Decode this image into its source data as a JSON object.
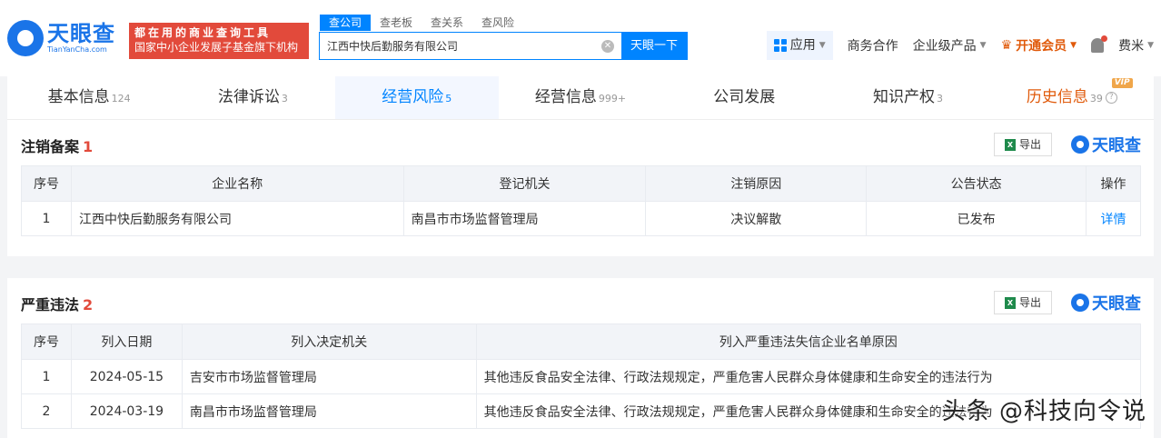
{
  "header": {
    "logo_cn": "天眼查",
    "logo_en": "TianYanCha.com",
    "slogan_line1": "都在用的商业查询工具",
    "slogan_line2": "国家中小企业发展子基金旗下机构",
    "search_tabs": [
      "查公司",
      "查老板",
      "查关系",
      "查风险"
    ],
    "search_value": "江西中快后勤服务有限公司",
    "search_button": "天眼一下",
    "app_label": "应用",
    "nav": [
      "商务合作",
      "企业级产品",
      "开通会员",
      "费米"
    ]
  },
  "tabs": [
    {
      "label": "基本信息",
      "count": "124"
    },
    {
      "label": "法律诉讼",
      "count": "3"
    },
    {
      "label": "经营风险",
      "count": "5"
    },
    {
      "label": "经营信息",
      "count": "999+"
    },
    {
      "label": "公司发展",
      "count": ""
    },
    {
      "label": "知识产权",
      "count": "3"
    },
    {
      "label": "历史信息",
      "count": "39"
    }
  ],
  "vip_badge": "VIP",
  "section1": {
    "title": "注销备案",
    "count": "1",
    "export": "导出",
    "brand": "天眼查",
    "columns": [
      "序号",
      "企业名称",
      "登记机关",
      "注销原因",
      "公告状态",
      "操作"
    ],
    "rows": [
      [
        "1",
        "江西中快后勤服务有限公司",
        "南昌市市场监督管理局",
        "决议解散",
        "已发布",
        "详情"
      ]
    ]
  },
  "section2": {
    "title": "严重违法",
    "count": "2",
    "export": "导出",
    "brand": "天眼查",
    "columns": [
      "序号",
      "列入日期",
      "列入决定机关",
      "列入严重违法失信企业名单原因"
    ],
    "rows": [
      [
        "1",
        "2024-05-15",
        "吉安市市场监督管理局",
        "其他违反食品安全法律、行政法规规定，严重危害人民群众身体健康和生命安全的违法行为"
      ],
      [
        "2",
        "2024-03-19",
        "南昌市市场监督管理局",
        "其他违反食品安全法律、行政法规规定，严重危害人民群众身体健康和生命安全的违法行为"
      ]
    ]
  },
  "watermark": "头条 @科技向令说"
}
